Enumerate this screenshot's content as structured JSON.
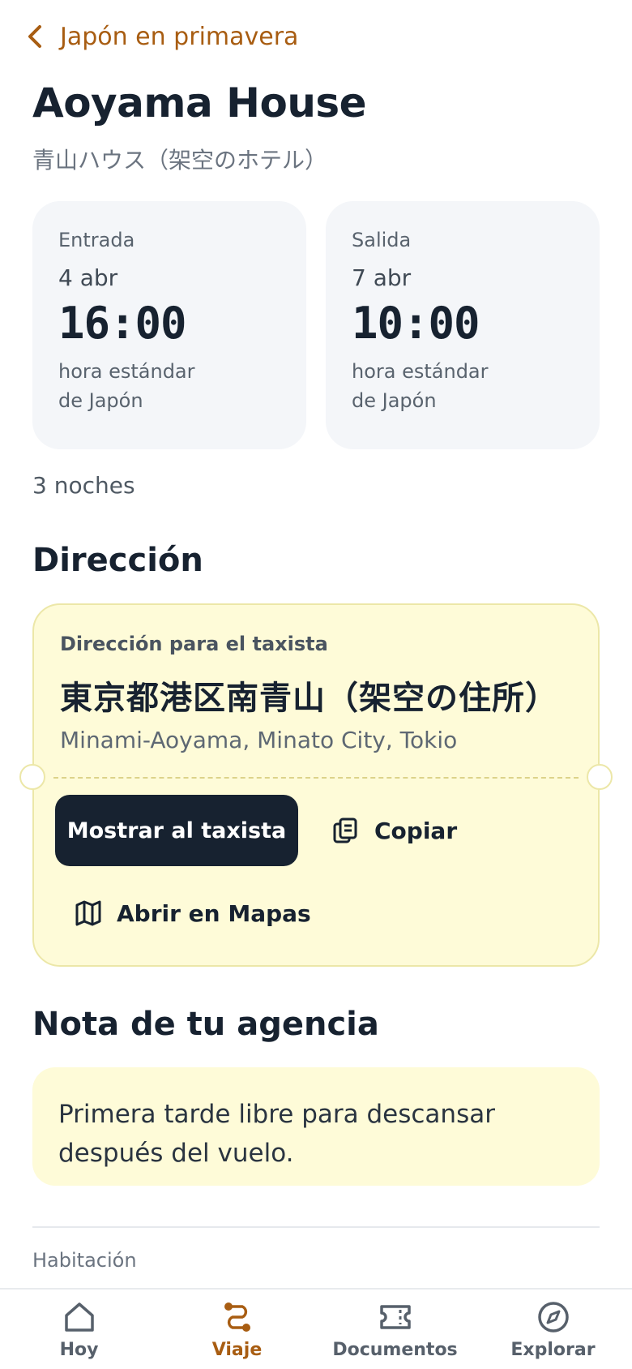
{
  "header": {
    "back_label": "Japón en primavera"
  },
  "hotel": {
    "name": "Aoyama House",
    "subtitle": "青山ハウス（架空のホテル）"
  },
  "checkin": {
    "label": "Entrada",
    "date": "4 abr",
    "time": "16:00",
    "tz_line1": "hora estándar",
    "tz_line2": "de Japón"
  },
  "checkout": {
    "label": "Salida",
    "date": "7 abr",
    "time": "10:00",
    "tz_line1": "hora estándar",
    "tz_line2": "de Japón"
  },
  "nights": "3 noches",
  "address_section": {
    "title": "Dirección",
    "card_label": "Dirección para el taxista",
    "address_jp": "東京都港区南青山（架空の住所）",
    "address_romaji": "Minami-Aoyama, Minato City, Tokio",
    "show_taxi_label": "Mostrar al taxista",
    "copy_label": "Copiar",
    "maps_label": "Abrir en Mapas"
  },
  "note_section": {
    "title": "Nota de tu agencia",
    "text": "Primera tarde libre para descansar después del vuelo."
  },
  "room_label": "Habitación",
  "tabs": [
    {
      "label": "Hoy",
      "icon": "home-icon",
      "active": false
    },
    {
      "label": "Viaje",
      "icon": "route-icon",
      "active": true
    },
    {
      "label": "Documentos",
      "icon": "ticket-icon",
      "active": false
    },
    {
      "label": "Explorar",
      "icon": "compass-icon",
      "active": false
    }
  ],
  "colors": {
    "accent": "#a85d12",
    "dark": "#172230",
    "card_yellow": "#fefbd8",
    "card_gray": "#f4f6f9"
  }
}
